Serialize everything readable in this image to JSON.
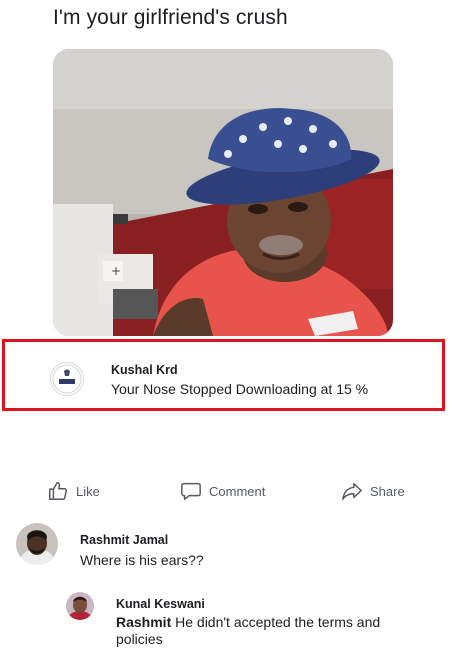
{
  "post": {
    "caption": "I'm your girlfriend's crush"
  },
  "highlighted_comment": {
    "author": "Kushal Krd",
    "avatar_text": "K.R.D",
    "text": "Your Nose Stopped Downloading at 15 %"
  },
  "actions": {
    "like": "Like",
    "comment": "Comment",
    "share": "Share"
  },
  "comments": [
    {
      "author": "Rashmit Jamal",
      "text": "Where is his ears??"
    },
    {
      "author": "Kunal Keswani",
      "mention": "Rashmit",
      "text_line1": " He didn't accepted the terms and",
      "text_line2": "policies"
    }
  ],
  "colors": {
    "highlight_border": "#e0141e",
    "action_text": "#555a61"
  }
}
